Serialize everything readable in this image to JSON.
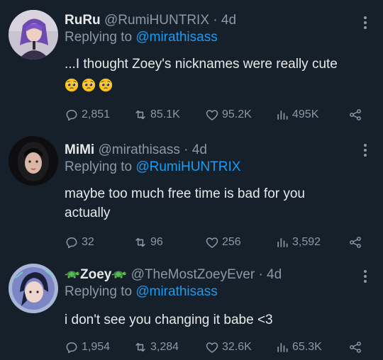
{
  "tweets": [
    {
      "display_name": "RuRu",
      "handle": "@RumiHUNTRIX",
      "dot": "·",
      "time": "4d",
      "replying_prefix": "Replying to",
      "replying_to": "@mirathisass",
      "text": "...I thought Zoey's nicknames were really cute",
      "emojis": [
        "pleading-face",
        "pleading-face",
        "pleading-face"
      ],
      "replies": "2,851",
      "retweets": "85.1K",
      "likes": "95.2K",
      "views": "495K"
    },
    {
      "display_name": "MiMi",
      "handle": "@mirathisass",
      "dot": "·",
      "time": "4d",
      "replying_prefix": "Replying to",
      "replying_to": "@RumiHUNTRIX",
      "text": "maybe too much free time is bad for you actually",
      "replies": "32",
      "retweets": "96",
      "likes": "256",
      "views": "3,592"
    },
    {
      "display_name": "Zoey",
      "name_decor_icon": "turtle-emoji",
      "handle": "@TheMostZoeyEver",
      "dot": "·",
      "time": "4d",
      "replying_prefix": "Replying to",
      "replying_to": "@mirathisass",
      "text": "i don't see you changing it babe <3",
      "replies": "1,954",
      "retweets": "3,284",
      "likes": "32.6K",
      "views": "65.3K"
    }
  ],
  "colors": {
    "background": "#15202b",
    "text_primary": "#e7e9ea",
    "text_secondary": "#8b98a5",
    "accent": "#1d9bf0"
  }
}
